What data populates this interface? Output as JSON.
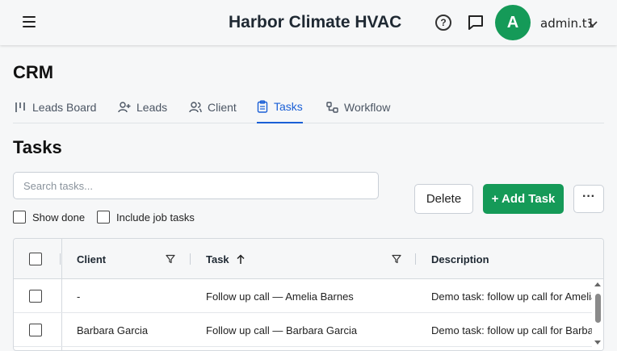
{
  "header": {
    "app_title": "Harbor Climate HVAC",
    "help_icon": "?",
    "avatar_letter": "A",
    "user_name": "admin.t1",
    "accent_color": "#159a58"
  },
  "page": {
    "section_title": "CRM",
    "tabs": [
      {
        "label": "Leads Board",
        "icon": "kanban-icon",
        "active": false
      },
      {
        "label": "Leads",
        "icon": "user-plus-icon",
        "active": false
      },
      {
        "label": "Client",
        "icon": "users-icon",
        "active": false
      },
      {
        "label": "Tasks",
        "icon": "clipboard-icon",
        "active": true
      },
      {
        "label": "Workflow",
        "icon": "workflow-icon",
        "active": false
      }
    ],
    "tab_active_color": "#1a5fd6"
  },
  "tasks": {
    "title": "Tasks",
    "search_placeholder": "Search tasks...",
    "show_done_label": "Show done",
    "include_job_tasks_label": "Include job tasks",
    "delete_label": "Delete",
    "add_label": "+ Add Task",
    "more_label": "···"
  },
  "grid": {
    "columns": [
      {
        "label": "Client",
        "filter": true,
        "sort": ""
      },
      {
        "label": "Task",
        "filter": true,
        "sort": "asc"
      },
      {
        "label": "Description",
        "filter": false,
        "sort": ""
      }
    ],
    "rows": [
      {
        "client": "-",
        "task": "Follow up call — Amelia Barnes",
        "description": "Demo task: follow up call for Amelia Barnes"
      },
      {
        "client": "Barbara Garcia",
        "task": "Follow up call — Barbara Garcia",
        "description": "Demo task: follow up call for Barbara Garcia"
      }
    ]
  }
}
